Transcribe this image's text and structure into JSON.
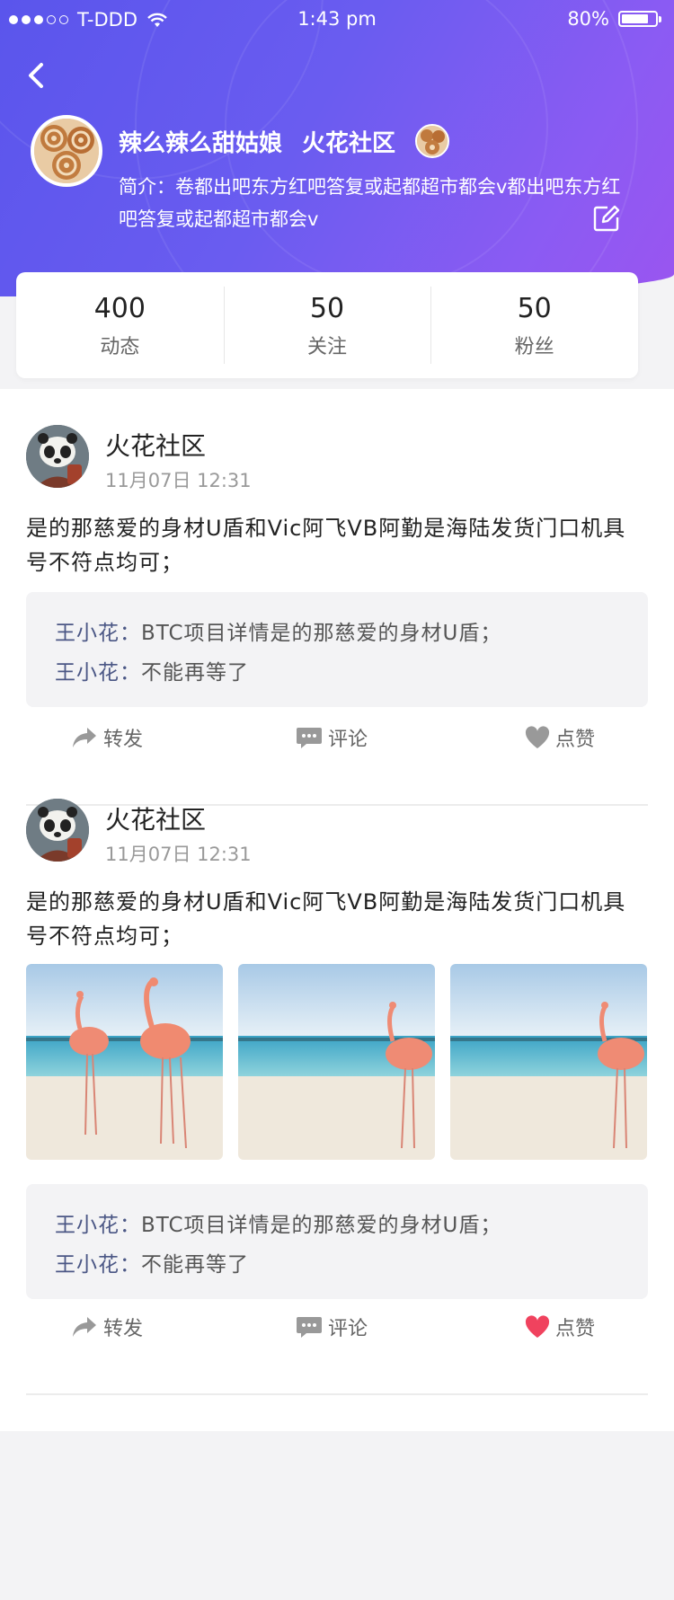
{
  "status_bar": {
    "carrier": "T-DDD",
    "time": "1:43 pm",
    "battery": "80%",
    "battery_level": 0.8
  },
  "profile": {
    "name": "辣么辣么甜姑娘",
    "community": "火花社区",
    "bio": "简介：卷都出吧东方红吧答复或起都超市都会v都出吧东方红吧答复或起都超市都会v"
  },
  "stats": [
    {
      "value": "400",
      "label": "动态"
    },
    {
      "value": "50",
      "label": "关注"
    },
    {
      "value": "50",
      "label": "粉丝"
    }
  ],
  "posts": [
    {
      "author": "火花社区",
      "time": "11月07日 12:31",
      "text": "是的那慈爱的身材U盾和Vic阿飞VB阿勤是海陆发货门口机具号不符点均可；",
      "comments": [
        {
          "user": "王小花：",
          "text": "BTC项目详情是的那慈爱的身材U盾；"
        },
        {
          "user": "王小花：",
          "text": "不能再等了"
        }
      ],
      "actions": {
        "share": "转发",
        "comment": "评论",
        "like": "点赞"
      },
      "liked": false
    },
    {
      "author": "火花社区",
      "time": "11月07日 12:31",
      "text": "是的那慈爱的身材U盾和Vic阿飞VB阿勤是海陆发货门口机具号不符点均可；",
      "images": [
        "flamingo-photo",
        "flamingo-photo",
        "flamingo-photo"
      ],
      "comments": [
        {
          "user": "王小花：",
          "text": "BTC项目详情是的那慈爱的身材U盾；"
        },
        {
          "user": "王小花：",
          "text": "不能再等了"
        }
      ],
      "actions": {
        "share": "转发",
        "comment": "评论",
        "like": "点赞"
      },
      "liked": true
    }
  ],
  "colors": {
    "header_start": "#5a55ec",
    "header_end": "#9a55f0",
    "comment_user": "#4b5785",
    "like_active": "#f0425e",
    "like_inactive": "#999999"
  }
}
